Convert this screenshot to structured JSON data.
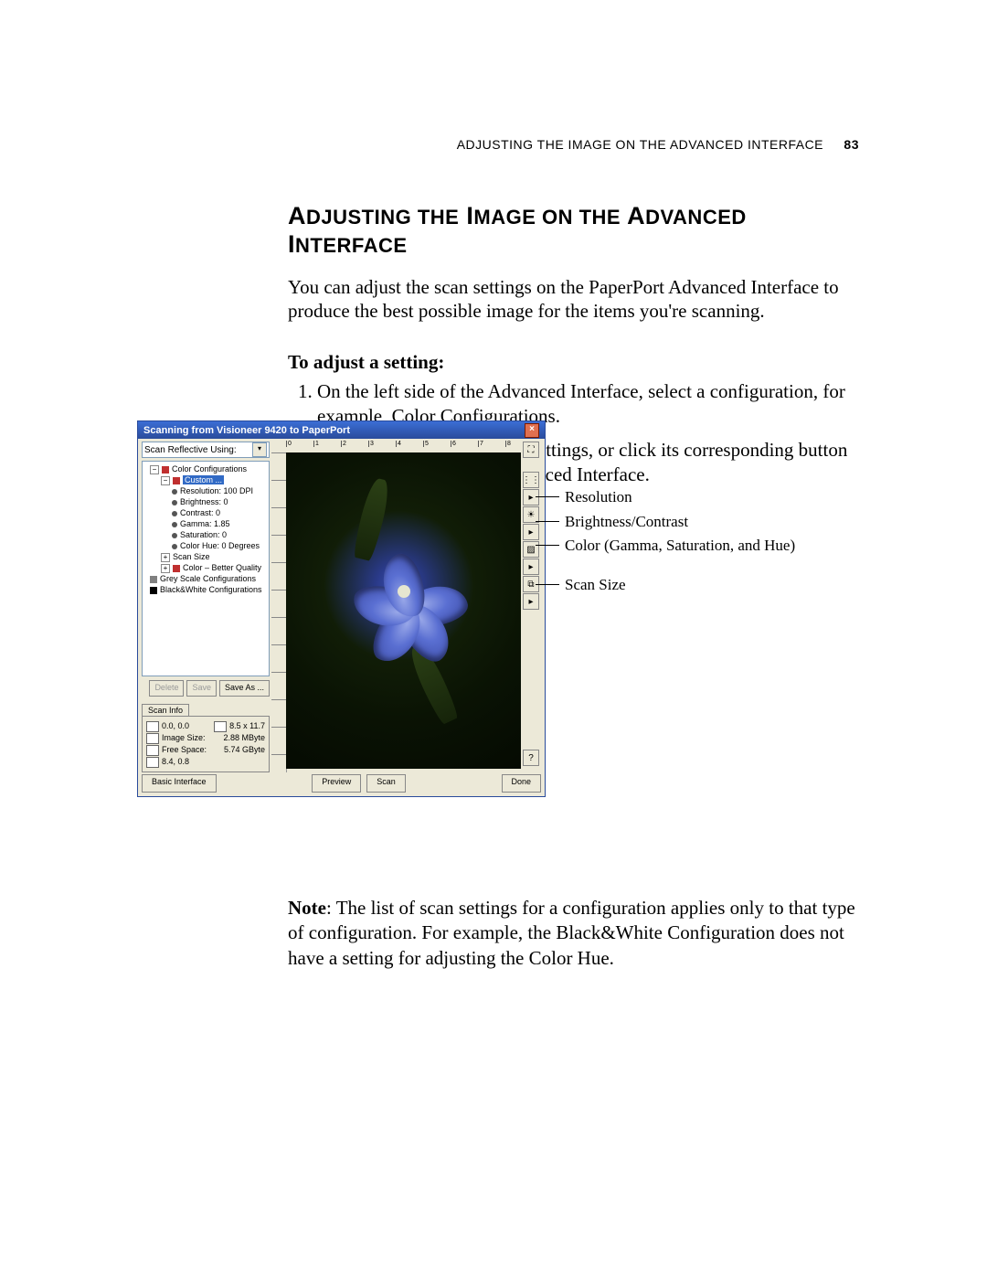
{
  "page": {
    "running_head": "ADJUSTING THE IMAGE ON THE ADVANCED INTERFACE",
    "number": "83",
    "heading_html": "A<span class='sc'>DJUSTING THE</span> I<span class='sc'>MAGE ON THE</span> A<span class='sc'>DVANCED</span> I<span class='sc'>NTERFACE</span>",
    "intro": "You can adjust the scan settings on the PaperPort Advanced Interface to produce the best possible image for the items you're scanning.",
    "subhead": "To adjust a setting:",
    "steps": [
      "On the left side of the Advanced Interface, select a configuration, for example, Color Configurations.",
      "Click a setting in the list of settings, or click its corresponding button on the right side of the Advanced Interface."
    ],
    "note_label": "Note",
    "note_body": ":  The list of scan settings for a configuration applies only to that type of configuration. For example, the Black&White Configuration does not have a setting for adjusting the Color Hue."
  },
  "app": {
    "title": "Scanning from Visioneer 9420 to PaperPort",
    "combo_label": "Scan Reflective Using:",
    "tree": {
      "color_config": "Color Configurations",
      "custom": "Custom ...",
      "resolution": "Resolution: 100 DPI",
      "brightness": "Brightness: 0",
      "contrast": "Contrast: 0",
      "gamma": "Gamma: 1.85",
      "saturation": "Saturation: 0",
      "hue": "Color Hue: 0 Degrees",
      "scan_size": "Scan Size",
      "better": "Color – Better Quality",
      "grey": "Grey Scale Configurations",
      "bw": "Black&White Configurations"
    },
    "buttons": {
      "delete": "Delete",
      "save": "Save",
      "save_as": "Save As ..."
    },
    "scan_info_tab": "Scan Info",
    "info": {
      "origin": "0.0, 0.0",
      "dims": "8.5 x 11.7",
      "img_label": "Image Size:",
      "img_val": "2.88 MByte",
      "free_label": "Free Space:",
      "free_val": "5.74 GByte",
      "box": "8.4, 0.8"
    },
    "bottom": {
      "basic": "Basic Interface",
      "preview": "Preview",
      "scan": "Scan",
      "done": "Done"
    },
    "ruler": [
      "0",
      "1",
      "2",
      "3",
      "4",
      "5",
      "6",
      "7",
      "8"
    ]
  },
  "callouts": {
    "resolution": "Resolution",
    "bc": "Brightness/Contrast",
    "color": "Color (Gamma, Saturation, and Hue)",
    "size": "Scan Size"
  }
}
